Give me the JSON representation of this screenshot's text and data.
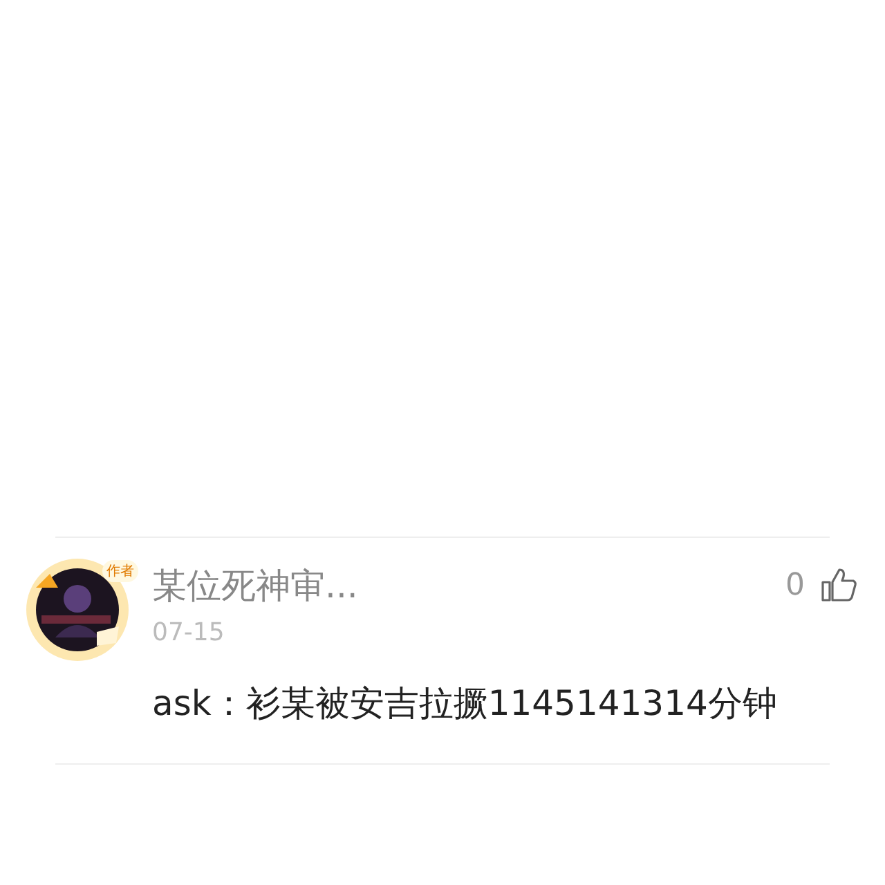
{
  "comments": [
    {
      "author": "某位死神审...",
      "badge": "作者",
      "date": "07-15",
      "likes": "0",
      "liked": false,
      "text": "ask：衫某被安吉拉撅1145141314分钟"
    }
  ]
}
